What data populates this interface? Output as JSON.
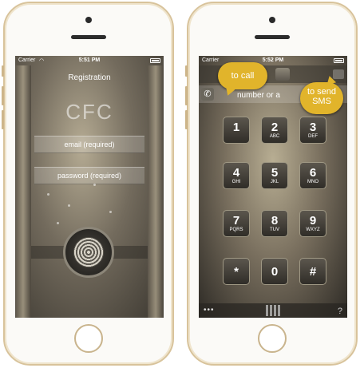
{
  "left_screen": {
    "status": {
      "carrier": "Carrier",
      "time": "5:51 PM"
    },
    "title": "Registration",
    "logo_text": "CFC",
    "email_placeholder": "email (required)",
    "password_placeholder": "password (required)"
  },
  "right_screen": {
    "status": {
      "carrier": "Carrier",
      "time": "5:52 PM"
    },
    "number_placeholder": "number or a",
    "bubble_call": "to call",
    "bubble_sms_line1": "to send",
    "bubble_sms_line2": "SMS",
    "keys": [
      {
        "digit": "1",
        "letters": ""
      },
      {
        "digit": "2",
        "letters": "ABC"
      },
      {
        "digit": "3",
        "letters": "DEF"
      },
      {
        "digit": "4",
        "letters": "GHI"
      },
      {
        "digit": "5",
        "letters": "JKL"
      },
      {
        "digit": "6",
        "letters": "MNO"
      },
      {
        "digit": "7",
        "letters": "PQRS"
      },
      {
        "digit": "8",
        "letters": "TUV"
      },
      {
        "digit": "9",
        "letters": "WXYZ"
      },
      {
        "digit": "*",
        "letters": ""
      },
      {
        "digit": "0",
        "letters": ""
      },
      {
        "digit": "#",
        "letters": ""
      }
    ],
    "help_label": "?"
  },
  "colors": {
    "bubble": "#e1b42b",
    "phone_frame": "#d8c39b"
  }
}
